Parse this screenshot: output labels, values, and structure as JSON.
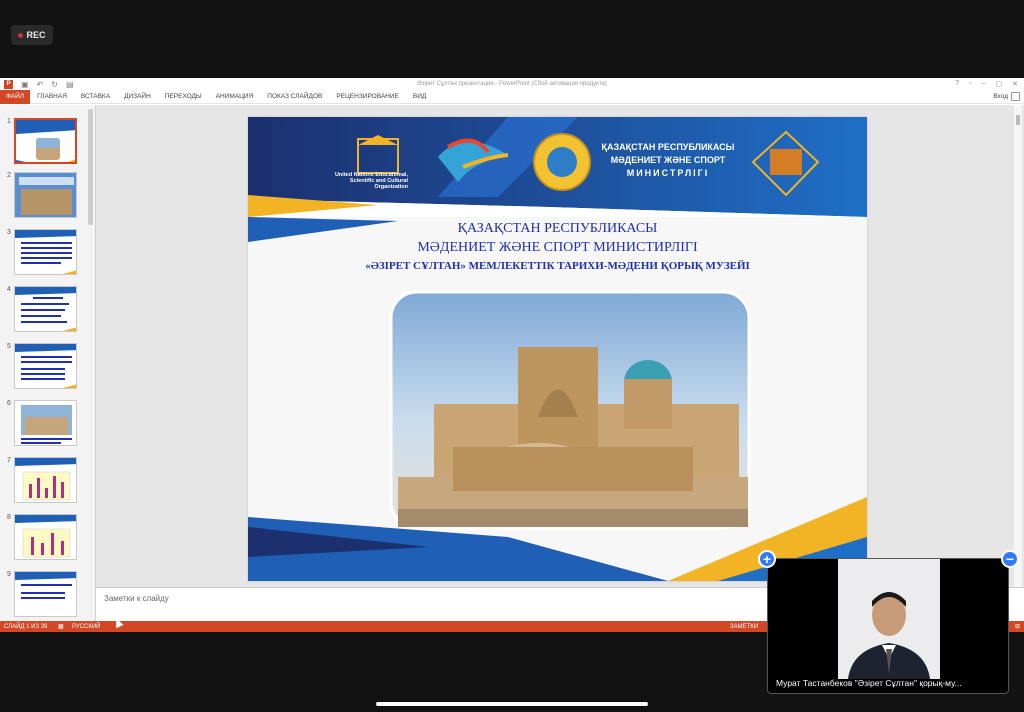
{
  "rec": {
    "label": "REC"
  },
  "window": {
    "title": "Әзірет Сұлтан презентация - PowerPoint (Сбой активации продукта)",
    "signin": "Вход"
  },
  "ribbon": {
    "tabs": [
      "ФАЙЛ",
      "ГЛАВНАЯ",
      "ВСТАВКА",
      "ДИЗАЙН",
      "ПЕРЕХОДЫ",
      "АНИМАЦИЯ",
      "ПОКАЗ СЛАЙДОВ",
      "РЕЦЕНЗИРОВАНИЕ",
      "ВИД"
    ]
  },
  "thumbnails": {
    "numbers": [
      "1",
      "2",
      "3",
      "4",
      "5",
      "6",
      "7",
      "8",
      "9"
    ],
    "selected": "1"
  },
  "slide": {
    "unesco_text": "United Nations Educational, Scientific and Cultural Organization",
    "ministry_line1": "ҚАЗАҚСТАН РЕСПУБЛИКАСЫ",
    "ministry_line2": "МӘДЕНИЕТ ЖӘНЕ СПОРТ",
    "ministry_line3": "МИНИСТРЛІГІ",
    "title_line1": "ҚАЗАҚСТАН РЕСПУБЛИКАСЫ",
    "title_line2": "МӘДЕНИЕТ ЖӘНЕ СПОРТ МИНИСТИРЛІГІ",
    "title_line3": "«ӘЗІРЕТ СҰЛТАН» МЕМЛЕКЕТТІК ТАРИХИ-МӘДЕНИ ҚОРЫҚ МУЗЕЙІ",
    "colors": {
      "blue": "#1f5fb5",
      "navy": "#1c2f6e",
      "gold": "#f2b324",
      "title": "#2030b0"
    }
  },
  "notes": {
    "placeholder": "Заметки к слайду"
  },
  "status": {
    "slide_info": "СЛАЙД 1 ИЗ 39",
    "language": "РУССКИЙ",
    "notes_button": "ЗАМЕТКИ"
  },
  "video": {
    "caption": "Мурат Тастанбеков \"Әзірет Сұлтан\" қорық-му..."
  },
  "controls": {
    "plus": "+",
    "minus": "−"
  }
}
